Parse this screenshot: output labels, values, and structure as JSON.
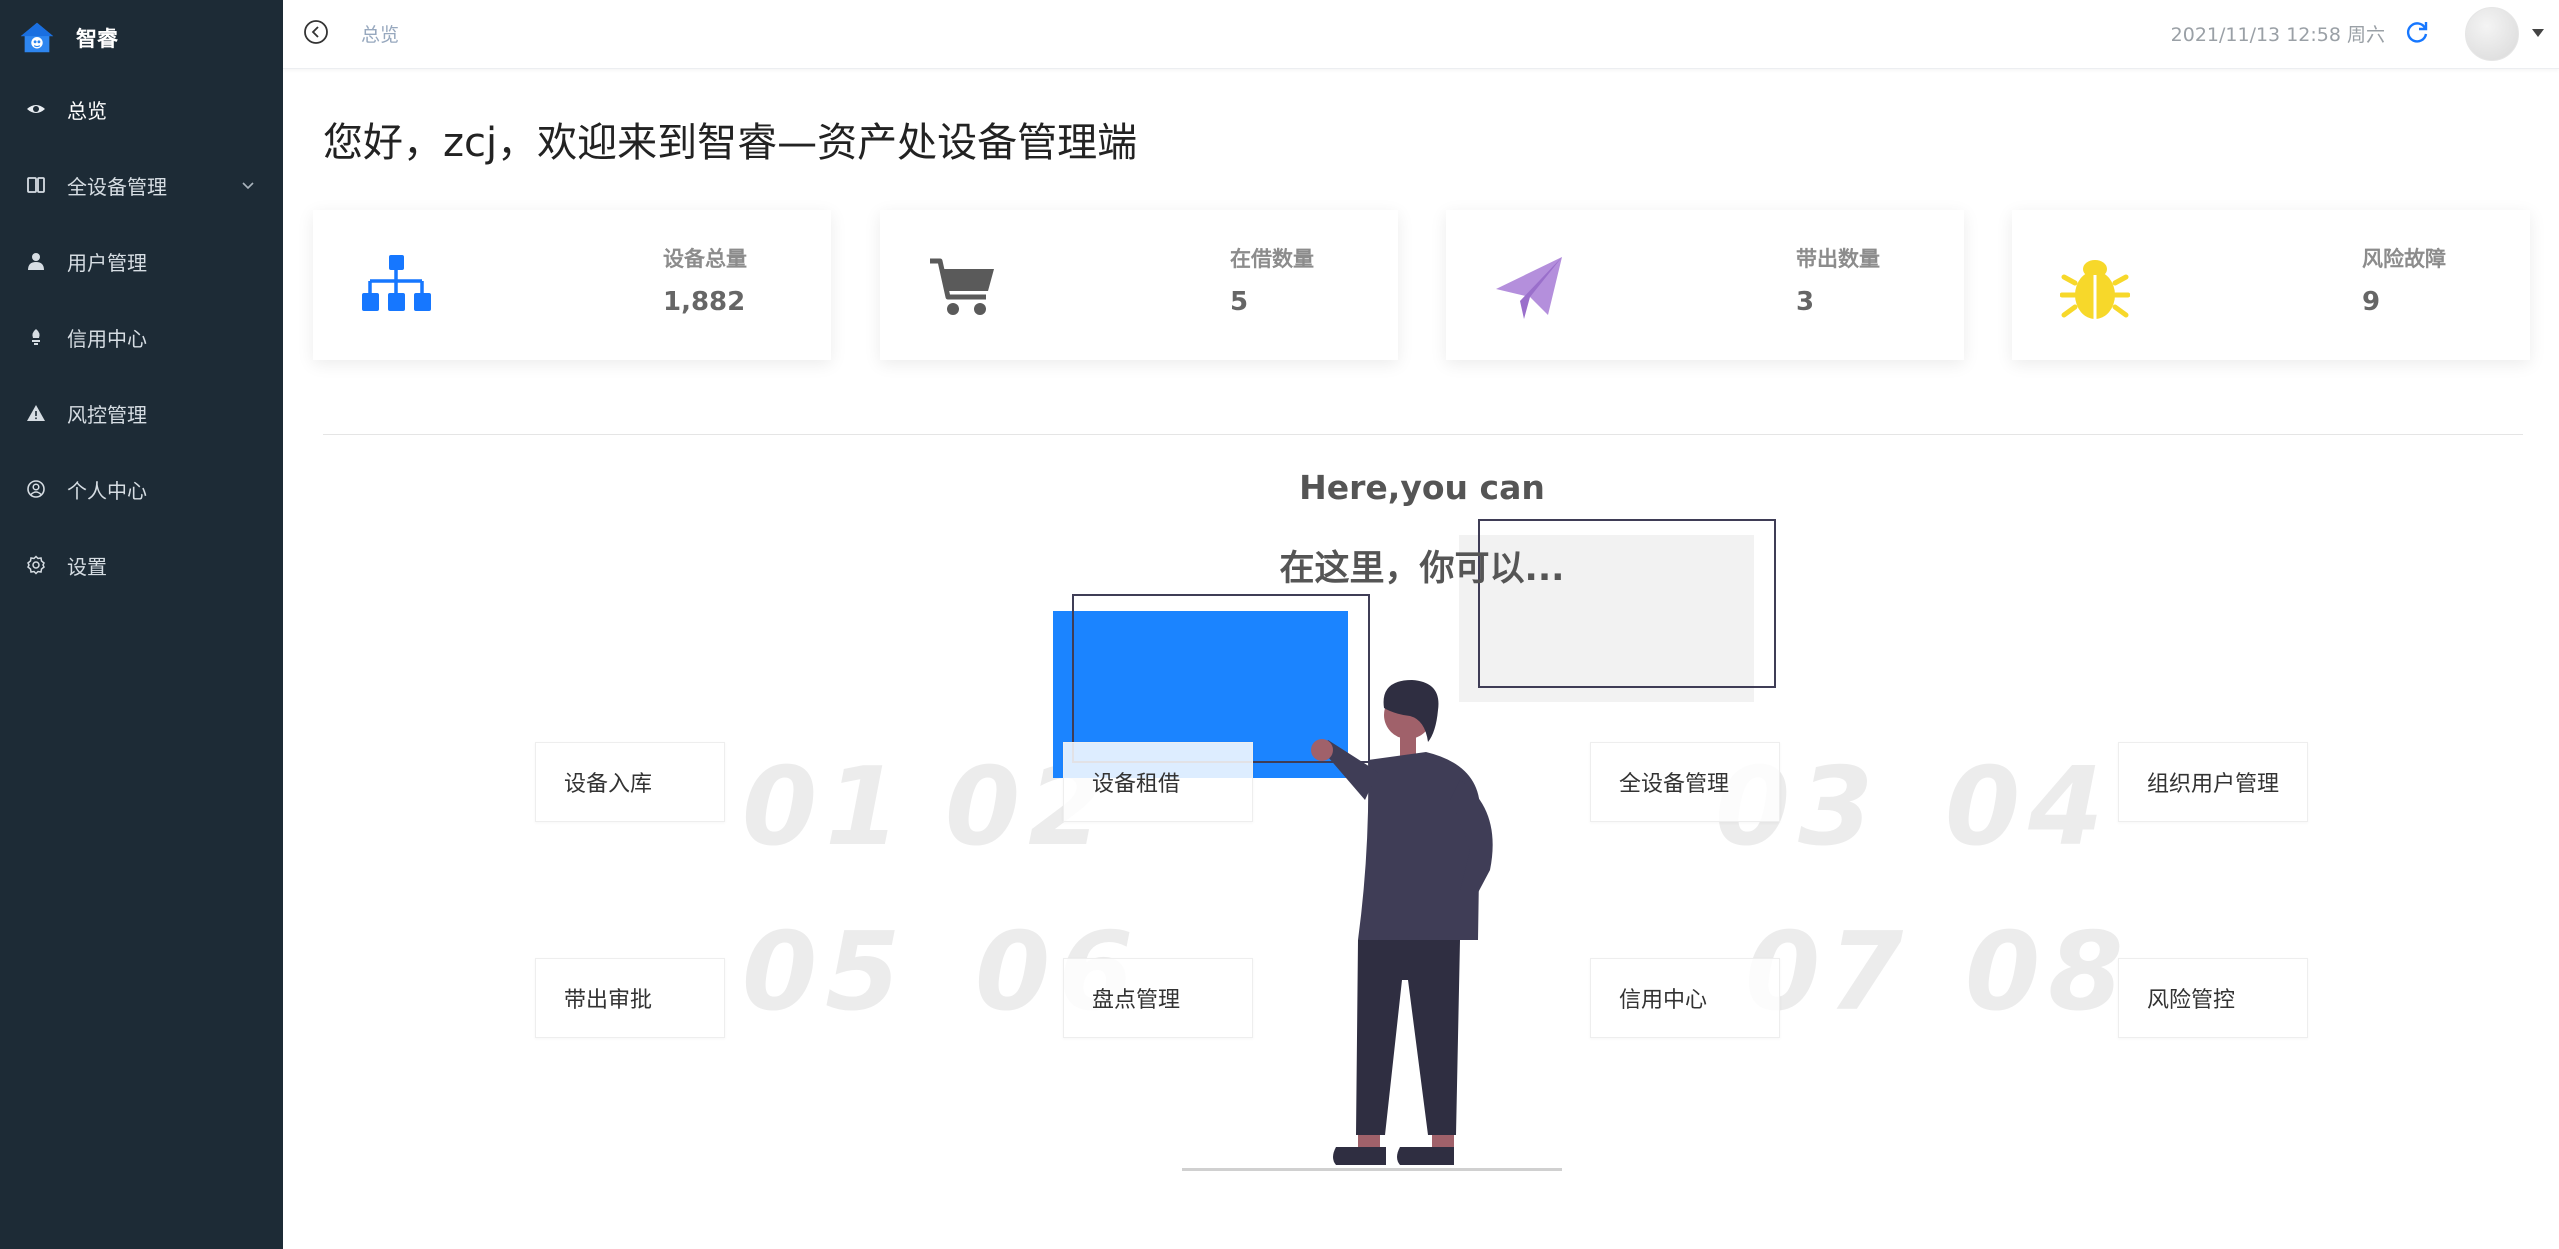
{
  "sidebar": {
    "brand": "智睿",
    "items": [
      {
        "label": "总览",
        "icon": "eye-icon"
      },
      {
        "label": "全设备管理",
        "icon": "devices-icon"
      },
      {
        "label": "用户管理",
        "icon": "user-icon"
      },
      {
        "label": "信用中心",
        "icon": "credit-icon"
      },
      {
        "label": "风控管理",
        "icon": "warning-icon"
      },
      {
        "label": "个人中心",
        "icon": "user-circle-icon"
      },
      {
        "label": "设置",
        "icon": "gear-icon"
      }
    ]
  },
  "header": {
    "breadcrumb": "总览",
    "datetime": "2021/11/13 12:58 周六"
  },
  "welcome": "您好，zcj，欢迎来到智睿—资产处设备管理端",
  "stats": [
    {
      "label": "设备总量",
      "value": "1,882",
      "icon": "sitemap-icon",
      "color": "#1677ff"
    },
    {
      "label": "在借数量",
      "value": "5",
      "icon": "cart-icon",
      "color": "#5a5a5a"
    },
    {
      "label": "带出数量",
      "value": "3",
      "icon": "paper-plane-icon",
      "color": "#a57fd0"
    },
    {
      "label": "风险故障",
      "value": "9",
      "icon": "bug-icon",
      "color": "#f7d82a"
    }
  ],
  "intro": {
    "title": "Here,you can",
    "subtitle": "在这里，你可以..."
  },
  "numbers": [
    "01",
    "02",
    "03",
    "04",
    "05",
    "06",
    "07",
    "08"
  ],
  "quick": [
    "设备入库",
    "设备租借",
    "全设备管理",
    "组织用户管理",
    "带出审批",
    "盘点管理",
    "信用中心",
    "风险管控"
  ],
  "colors": {
    "sidebar_bg": "#1d2b36",
    "accent": "#1677ff"
  }
}
